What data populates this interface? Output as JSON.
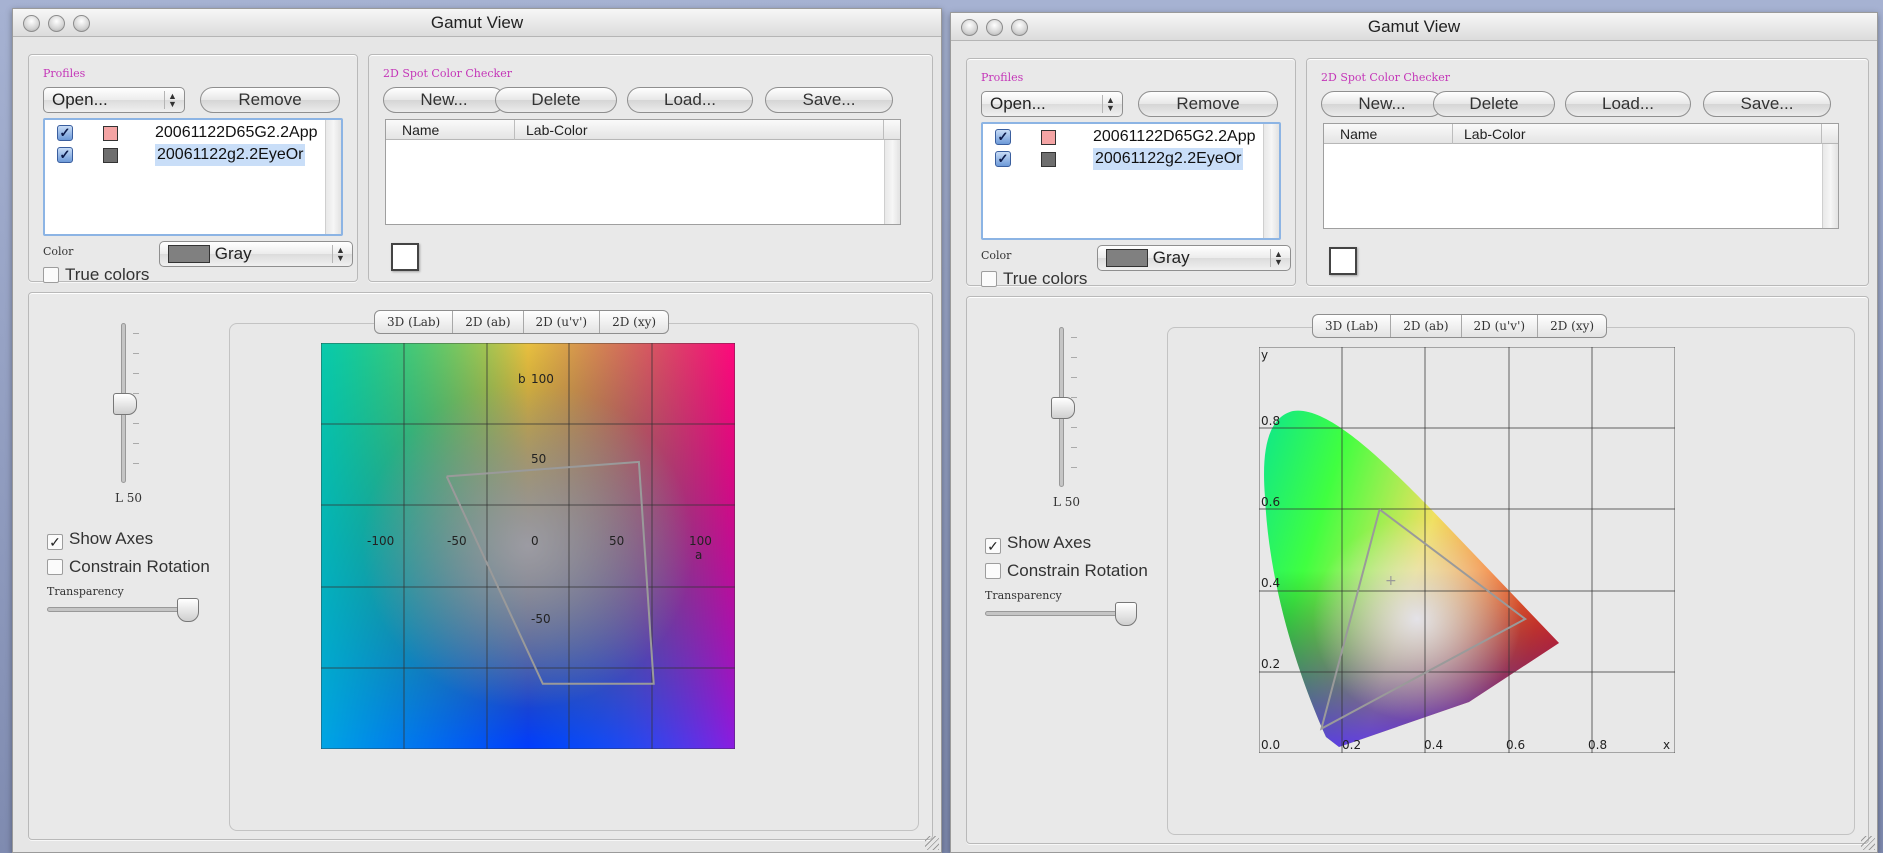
{
  "windows": [
    {
      "title": "Gamut View",
      "profiles": {
        "caption": "Profiles",
        "open_label": "Open...",
        "remove_label": "Remove",
        "items": [
          {
            "label": "20061122D65G2.2App",
            "checked": true,
            "swatch": "#f4a4a4",
            "selected": false
          },
          {
            "label": "20061122g2.2EyeOr",
            "checked": true,
            "swatch": "#6e6e6e",
            "selected": true
          }
        ],
        "color_caption": "Color",
        "color_value": "Gray",
        "color_swatch": "#808080",
        "true_colors_label": "True colors",
        "true_colors_checked": false
      },
      "spot": {
        "caption": "2D Spot Color Checker",
        "buttons": [
          "New...",
          "Delete",
          "Load...",
          "Save..."
        ],
        "columns": [
          "Name",
          "Lab-Color"
        ]
      },
      "view": {
        "tabs": [
          "3D (Lab)",
          "2D (ab)",
          "2D (u'v')",
          "2D (xy)"
        ],
        "l_label": "L 50",
        "show_axes_label": "Show Axes",
        "show_axes_checked": true,
        "constrain_rotation_label": "Constrain Rotation",
        "constrain_rotation_checked": false,
        "transparency_caption": "Transparency",
        "l_value": 50,
        "transparency_value": 1.0
      },
      "plot": {
        "type": "ab",
        "axis_b_label": "b",
        "axis_a_label": "a",
        "labels": [
          "100",
          "50",
          "-100",
          "-50",
          "0",
          "50",
          "100",
          "-50"
        ]
      }
    },
    {
      "title": "Gamut View",
      "profiles": {
        "caption": "Profiles",
        "open_label": "Open...",
        "remove_label": "Remove",
        "items": [
          {
            "label": "20061122D65G2.2App",
            "checked": true,
            "swatch": "#f4a4a4",
            "selected": false
          },
          {
            "label": "20061122g2.2EyeOr",
            "checked": true,
            "swatch": "#6e6e6e",
            "selected": true
          }
        ],
        "color_caption": "Color",
        "color_value": "Gray",
        "color_swatch": "#808080",
        "true_colors_label": "True colors",
        "true_colors_checked": false
      },
      "spot": {
        "caption": "2D Spot Color Checker",
        "buttons": [
          "New...",
          "Delete",
          "Load...",
          "Save..."
        ],
        "columns": [
          "Name",
          "Lab-Color"
        ]
      },
      "view": {
        "tabs": [
          "3D (Lab)",
          "2D (ab)",
          "2D (u'v')",
          "2D (xy)"
        ],
        "l_label": "L 50",
        "show_axes_label": "Show Axes",
        "show_axes_checked": true,
        "constrain_rotation_label": "Constrain Rotation",
        "constrain_rotation_checked": false,
        "transparency_caption": "Transparency",
        "l_value": 50,
        "transparency_value": 1.0
      },
      "plot": {
        "type": "xy",
        "axis_y_label": "y",
        "axis_x_label": "x",
        "y_ticks": [
          "0.8",
          "0.6",
          "0.4",
          "0.2"
        ],
        "x_ticks": [
          "0.0",
          "0.2",
          "0.4",
          "0.6",
          "0.8"
        ]
      }
    }
  ],
  "chart_data": [
    {
      "type": "scatter",
      "title": "",
      "xlabel": "a",
      "ylabel": "b",
      "xlim": [
        -140,
        140
      ],
      "ylim": [
        -140,
        140
      ],
      "series": [
        {
          "values": [
            [
              -55,
              48
            ],
            [
              75,
              58
            ],
            [
              85,
              -95
            ],
            [
              10,
              -95
            ],
            [
              -55,
              48
            ]
          ]
        }
      ]
    },
    {
      "type": "scatter",
      "title": "",
      "xlabel": "x",
      "ylabel": "y",
      "xlim": [
        0,
        1
      ],
      "ylim": [
        0,
        1
      ],
      "series": [
        {
          "values": [
            [
              0.29,
              0.6
            ],
            [
              0.64,
              0.33
            ],
            [
              0.15,
              0.06
            ],
            [
              0.29,
              0.6
            ]
          ]
        }
      ]
    }
  ]
}
